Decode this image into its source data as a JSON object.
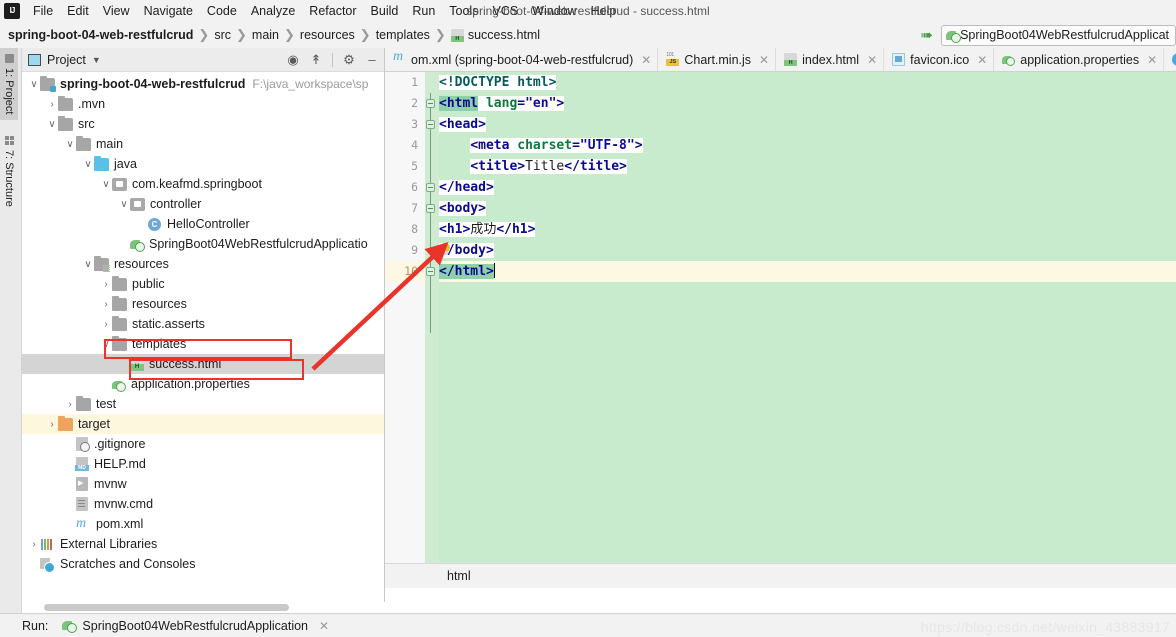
{
  "window": {
    "title": "spring-boot-04-web-restfulcrud - success.html",
    "logo": "intellij-idea-logo"
  },
  "menubar": {
    "items": [
      "File",
      "Edit",
      "View",
      "Navigate",
      "Code",
      "Analyze",
      "Refactor",
      "Build",
      "Run",
      "Tools",
      "VCS",
      "Window",
      "Help"
    ]
  },
  "navbar": {
    "breadcrumbs": [
      "spring-boot-04-web-restfulcrud",
      "src",
      "main",
      "resources",
      "templates",
      "success.html"
    ],
    "run_configuration": "SpringBoot04WebRestfulcrudApplicat",
    "arrow_icon": "arrow-up-icon"
  },
  "toolstrip": {
    "items": [
      {
        "label": "1: Project",
        "icon": "project-icon",
        "active": true
      },
      {
        "label": "7: Structure",
        "icon": "structure-icon",
        "active": false
      }
    ]
  },
  "project_panel": {
    "title": "Project",
    "tools": [
      "locate-icon",
      "collapse-all-icon",
      "settings-gear-icon",
      "hide-icon"
    ],
    "tree": [
      {
        "indent": 0,
        "expander": "v",
        "icon": "module-folder-icon",
        "label": "spring-boot-04-web-restfulcrud",
        "bold": true,
        "path": "F:\\java_workspace\\sp",
        "state": "normal"
      },
      {
        "indent": 1,
        "expander": ">",
        "icon": "folder-icon",
        "label": ".mvn",
        "state": "normal"
      },
      {
        "indent": 1,
        "expander": "v",
        "icon": "folder-icon",
        "label": "src",
        "state": "normal"
      },
      {
        "indent": 2,
        "expander": "v",
        "icon": "folder-icon",
        "label": "main",
        "state": "normal"
      },
      {
        "indent": 3,
        "expander": "v",
        "icon": "source-folder-icon",
        "label": "java",
        "state": "normal"
      },
      {
        "indent": 4,
        "expander": "v",
        "icon": "package-icon",
        "label": "com.keafmd.springboot",
        "state": "normal"
      },
      {
        "indent": 5,
        "expander": "v",
        "icon": "package-icon",
        "label": "controller",
        "state": "normal"
      },
      {
        "indent": 6,
        "expander": "",
        "icon": "java-class-icon",
        "label": "HelloController",
        "state": "normal"
      },
      {
        "indent": 5,
        "expander": "",
        "icon": "spring-boot-class-icon",
        "label": "SpringBoot04WebRestfulcrudApplicatio",
        "state": "normal"
      },
      {
        "indent": 3,
        "expander": "v",
        "icon": "resources-folder-icon",
        "label": "resources",
        "state": "normal"
      },
      {
        "indent": 4,
        "expander": ">",
        "icon": "folder-icon",
        "label": "public",
        "state": "normal"
      },
      {
        "indent": 4,
        "expander": ">",
        "icon": "folder-icon",
        "label": "resources",
        "state": "normal"
      },
      {
        "indent": 4,
        "expander": ">",
        "icon": "folder-icon",
        "label": "static.asserts",
        "state": "normal"
      },
      {
        "indent": 4,
        "expander": "v",
        "icon": "folder-icon",
        "label": "templates",
        "state": "normal"
      },
      {
        "indent": 5,
        "expander": "",
        "icon": "html-file-icon",
        "label": "success.html",
        "state": "selected"
      },
      {
        "indent": 4,
        "expander": "",
        "icon": "properties-file-icon",
        "label": "application.properties",
        "state": "normal"
      },
      {
        "indent": 2,
        "expander": ">",
        "icon": "folder-icon",
        "label": "test",
        "state": "normal"
      },
      {
        "indent": 1,
        "expander": ">",
        "icon": "target-folder-icon",
        "label": "target",
        "state": "highlighted"
      },
      {
        "indent": 2,
        "expander": "",
        "icon": "gitignore-file-icon",
        "label": ".gitignore",
        "state": "normal"
      },
      {
        "indent": 2,
        "expander": "",
        "icon": "markdown-file-icon",
        "label": "HELP.md",
        "state": "normal"
      },
      {
        "indent": 2,
        "expander": "",
        "icon": "shell-script-icon",
        "label": "mvnw",
        "state": "normal"
      },
      {
        "indent": 2,
        "expander": "",
        "icon": "cmd-file-icon",
        "label": "mvnw.cmd",
        "state": "normal"
      },
      {
        "indent": 2,
        "expander": "",
        "icon": "maven-pom-icon",
        "label": "pom.xml",
        "state": "normal"
      },
      {
        "indent": 0,
        "expander": ">",
        "icon": "external-libraries-icon",
        "label": "External Libraries",
        "state": "normal"
      },
      {
        "indent": 0,
        "expander": "",
        "icon": "scratches-icon",
        "label": "Scratches and Consoles",
        "state": "normal"
      }
    ]
  },
  "editor": {
    "tabs": [
      {
        "label": "om.xml (spring-boot-04-web-restfulcrud)",
        "icon": "maven-pom-icon",
        "active": false,
        "closable": true
      },
      {
        "label": "Chart.min.js",
        "icon": "javascript-file-icon",
        "active": false,
        "closable": true
      },
      {
        "label": "index.html",
        "icon": "html-file-icon",
        "active": false,
        "closable": true
      },
      {
        "label": "favicon.ico",
        "icon": "image-file-icon",
        "active": false,
        "closable": true
      },
      {
        "label": "application.properties",
        "icon": "properties-file-icon",
        "active": false,
        "closable": true
      }
    ],
    "line_numbers": [
      "1",
      "2",
      "3",
      "4",
      "5",
      "6",
      "7",
      "8",
      "9",
      "10"
    ],
    "current_line": 10,
    "lines": [
      {
        "n": 1,
        "text": "<!DOCTYPE html>"
      },
      {
        "n": 2,
        "text": "<html lang=\"en\">"
      },
      {
        "n": 3,
        "text": "<head>"
      },
      {
        "n": 4,
        "text": "    <meta charset=\"UTF-8\">"
      },
      {
        "n": 5,
        "text": "    <title>Title</title>"
      },
      {
        "n": 6,
        "text": "</head>"
      },
      {
        "n": 7,
        "text": "<body>"
      },
      {
        "n": 8,
        "text": "<h1>成功</h1>"
      },
      {
        "n": 9,
        "text": "</body>"
      },
      {
        "n": 10,
        "text": "</html>"
      }
    ],
    "breadcrumb": "html",
    "background_color": "#c9ebcd",
    "current_line_color": "#fdf8e3"
  },
  "runbar": {
    "label": "Run:",
    "configuration": "SpringBoot04WebRestfulcrudApplication",
    "icon": "spring-boot-run-icon"
  },
  "annotations": {
    "watermark": "https://blog.csdn.net/weixin_43883917",
    "highlight_color": "#e8342a",
    "boxes": [
      "templates-highlight-box",
      "success-html-highlight-box"
    ],
    "arrow": "red-pointer-arrow"
  }
}
